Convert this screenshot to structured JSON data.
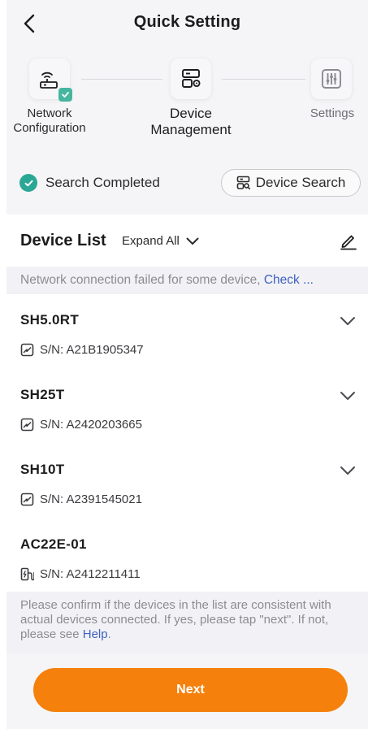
{
  "header": {
    "title": "Quick Setting"
  },
  "stepper": {
    "steps": [
      {
        "label_line1": "Network",
        "label_line2": "Configuration",
        "icon": "router-icon",
        "completed": true
      },
      {
        "label_line1": "Device",
        "label_line2": "Management",
        "icon": "device-manage-icon",
        "active": true
      },
      {
        "label_line1": "Settings",
        "label_line2": "",
        "icon": "sliders-icon"
      }
    ]
  },
  "search": {
    "status": "Search Completed",
    "button_label": "Device Search"
  },
  "device_list": {
    "title": "Device List",
    "expand_label": "Expand All",
    "warning_text": "Network connection failed for some device,",
    "warning_link": "Check ...",
    "devices": [
      {
        "name": "SH5.0RT",
        "sn": "S/N: A21B1905347",
        "icon": "inverter-icon",
        "expandable": true
      },
      {
        "name": "SH25T",
        "sn": "S/N: A2420203665",
        "icon": "inverter-icon",
        "expandable": true
      },
      {
        "name": "SH10T",
        "sn": "S/N: A2391545021",
        "icon": "inverter-icon",
        "expandable": true
      },
      {
        "name": "AC22E-01",
        "sn": "S/N: A2412211411",
        "icon": "ev-charger-icon",
        "expandable": false
      }
    ],
    "confirm_text": "Please confirm if the devices in the list are consistent with actual devices connected. If yes, please tap \"next\". If not, please see",
    "confirm_link": "Help",
    "confirm_end": "."
  },
  "footer": {
    "next_label": "Next"
  },
  "colors": {
    "accent": "#f5800b",
    "success": "#2aa795",
    "link": "#3f61c2"
  }
}
